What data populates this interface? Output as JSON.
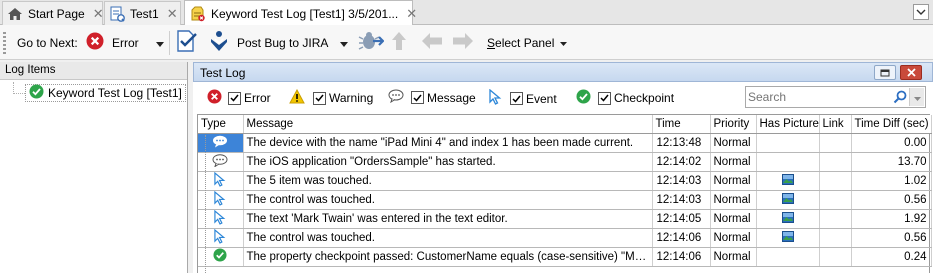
{
  "tabs": [
    {
      "label": "Start Page",
      "icon": "home-icon",
      "close": "✕"
    },
    {
      "label": "Test1",
      "icon": "test-document-icon",
      "close": "✕"
    },
    {
      "label": "Keyword Test Log [Test1] 3/5/201...",
      "icon": "keyword-log-icon",
      "close": "✕",
      "active": true
    }
  ],
  "toolbar": {
    "go_to_next_label": "Go to Next:",
    "error_label": "Error",
    "post_bug_label": "Post Bug to JIRA",
    "select_panel_label": "Select Panel",
    "select_panel_underline": "S",
    "select_panel_rest": "elect Panel"
  },
  "left_panel": {
    "header": "Log Items",
    "item_label": "Keyword Test Log [Test1]"
  },
  "test_log": {
    "title": "Test Log",
    "filters": [
      {
        "label": "Error",
        "checked": true,
        "icon": "error-icon"
      },
      {
        "label": "Warning",
        "checked": true,
        "icon": "warning-icon"
      },
      {
        "label": "Message",
        "checked": true,
        "icon": "message-icon"
      },
      {
        "label": "Event",
        "checked": true,
        "icon": "event-cursor-icon"
      },
      {
        "label": "Checkpoint",
        "checked": true,
        "icon": "checkpoint-icon"
      }
    ],
    "search_placeholder": "Search",
    "columns": [
      "Type",
      "Message",
      "Time",
      "Priority",
      "Has Picture",
      "Link",
      "Time Diff (sec)"
    ],
    "rows": [
      {
        "type": "message-selected",
        "message": "The device with the name \"iPad Mini 4\" and index 1 has been made current.",
        "time": "12:13:48",
        "priority": "Normal",
        "has_picture": false,
        "link": "",
        "diff": "0.00"
      },
      {
        "type": "message",
        "message": "The iOS application \"OrdersSample\" has started.",
        "time": "12:14:02",
        "priority": "Normal",
        "has_picture": false,
        "link": "",
        "diff": "13.70"
      },
      {
        "type": "event",
        "message": "The 5 item was touched.",
        "time": "12:14:03",
        "priority": "Normal",
        "has_picture": true,
        "link": "",
        "diff": "1.02"
      },
      {
        "type": "event",
        "message": "The control was touched.",
        "time": "12:14:03",
        "priority": "Normal",
        "has_picture": true,
        "link": "",
        "diff": "0.56"
      },
      {
        "type": "event",
        "message": "The text 'Mark Twain' was entered in the text editor.",
        "time": "12:14:05",
        "priority": "Normal",
        "has_picture": true,
        "link": "",
        "diff": "1.92"
      },
      {
        "type": "event",
        "message": "The control was touched.",
        "time": "12:14:06",
        "priority": "Normal",
        "has_picture": true,
        "link": "",
        "diff": "0.56"
      },
      {
        "type": "checkpoint",
        "message": "The property checkpoint passed: CustomerName equals (case-sensitive) \"Mark Twain\".",
        "time": "12:14:06",
        "priority": "Normal",
        "has_picture": false,
        "link": "",
        "diff": "0.24"
      }
    ]
  },
  "colors": {
    "error": "#d0202a",
    "warning": "#f2c500",
    "checkpoint": "#2ea44a",
    "event": "#2d87d8",
    "selection": "#3d84d8",
    "jira_blue": "#1d4e8f"
  }
}
